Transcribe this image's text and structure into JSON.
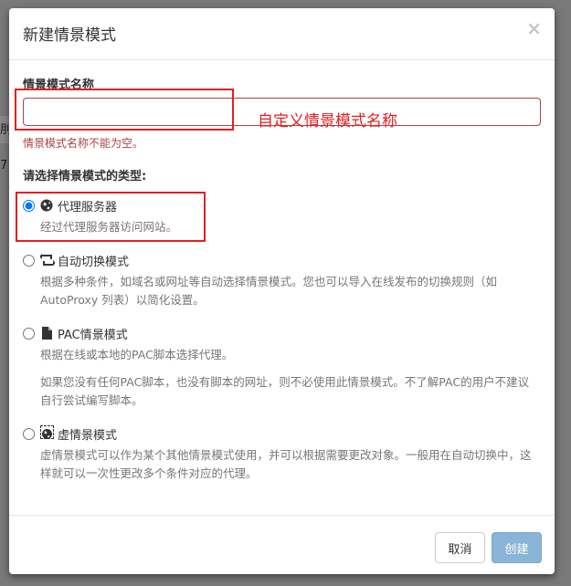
{
  "background": {
    "snippet_1": "刖",
    "snippet_2": "7"
  },
  "modal": {
    "title": "新建情景模式",
    "close_label": "×",
    "name_field_label": "情景模式名称",
    "name_input_value": "",
    "name_input_annotation": "自定义情景模式名称",
    "name_error": "情景模式名称不能为空。",
    "type_section_label": "请选择情景模式的类型:",
    "options": [
      {
        "icon": "globe-icon",
        "title": "代理服务器",
        "selected": true,
        "desc": "经过代理服务器访问网站。"
      },
      {
        "icon": "retweet-icon",
        "title": "自动切换模式",
        "selected": false,
        "desc": "根据多种条件，如域名或网址等自动选择情景模式。您也可以导入在线发布的切换规则（如 AutoProxy 列表）以简化设置。"
      },
      {
        "icon": "file-icon",
        "title": "PAC情景模式",
        "selected": false,
        "desc": "根据在线或本地的PAC脚本选择代理。",
        "desc2": "如果您没有任何PAC脚本，也没有脚本的网址，则不必使用此情景模式。不了解PAC的用户不建议自行尝试编写脚本。"
      },
      {
        "icon": "virtual-globe-icon",
        "title": "虚情景模式",
        "selected": false,
        "desc": "虚情景模式可以作为某个其他情景模式使用，并可以根据需要更改对象。一般用在自动切换中，这样就可以一次性更改多个条件对应的代理。"
      }
    ],
    "cancel_label": "取消",
    "create_label": "创建"
  },
  "colors": {
    "annotation": "#e41f1f",
    "error": "#a94442",
    "primary_disabled": "#8ab4d8"
  }
}
